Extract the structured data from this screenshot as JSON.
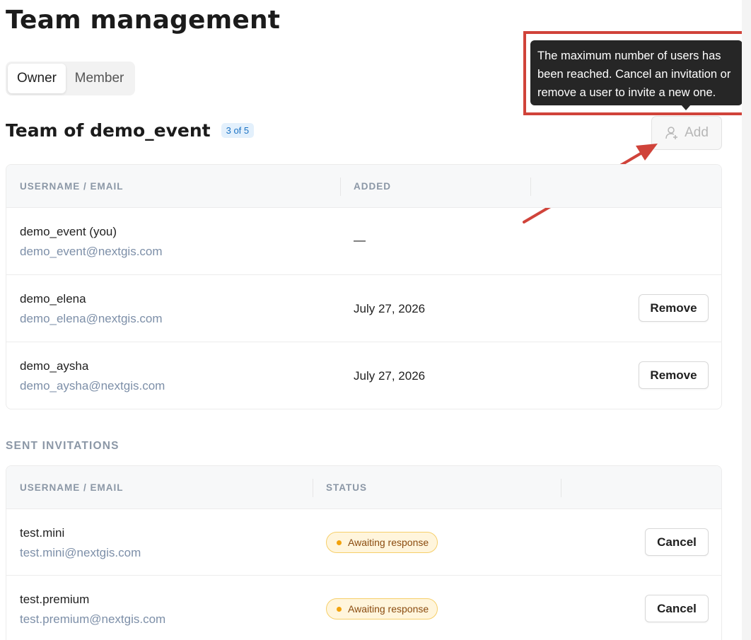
{
  "page": {
    "title": "Team management"
  },
  "role_tabs": [
    {
      "label": "Owner",
      "active": true
    },
    {
      "label": "Member",
      "active": false
    }
  ],
  "team": {
    "title": "Team of demo_event",
    "count_badge": "3 of 5",
    "add_button": {
      "label": "Add",
      "disabled": true
    },
    "tooltip": "The maximum number of users has been reached. Cancel an invitation or remove a user to invite a new one.",
    "columns": [
      "USERNAME / EMAIL",
      "ADDED"
    ],
    "members": [
      {
        "username": "demo_event (you)",
        "email": "demo_event@nextgis.com",
        "added": "—",
        "action": ""
      },
      {
        "username": "demo_elena",
        "email": "demo_elena@nextgis.com",
        "added": "July 27, 2026",
        "action": "Remove"
      },
      {
        "username": "demo_aysha",
        "email": "demo_aysha@nextgis.com",
        "added": "July 27, 2026",
        "action": "Remove"
      }
    ]
  },
  "invitations": {
    "title": "SENT INVITATIONS",
    "columns": [
      "USERNAME / EMAIL",
      "STATUS"
    ],
    "items": [
      {
        "username": "test.mini",
        "email": "test.mini@nextgis.com",
        "status": "Awaiting response",
        "action": "Cancel"
      },
      {
        "username": "test.premium",
        "email": "test.premium@nextgis.com",
        "status": "Awaiting response",
        "action": "Cancel"
      }
    ]
  },
  "colors": {
    "accent_badge_bg": "#e3f0fc",
    "accent_badge_text": "#1c73c4",
    "status_pending_bg": "#fff5dc",
    "status_pending_dot": "#f2a20c",
    "annotation_red": "#d0433a"
  },
  "icons": {
    "add_button_icon": "user-add-icon",
    "status_dot": "status-dot-icon"
  }
}
